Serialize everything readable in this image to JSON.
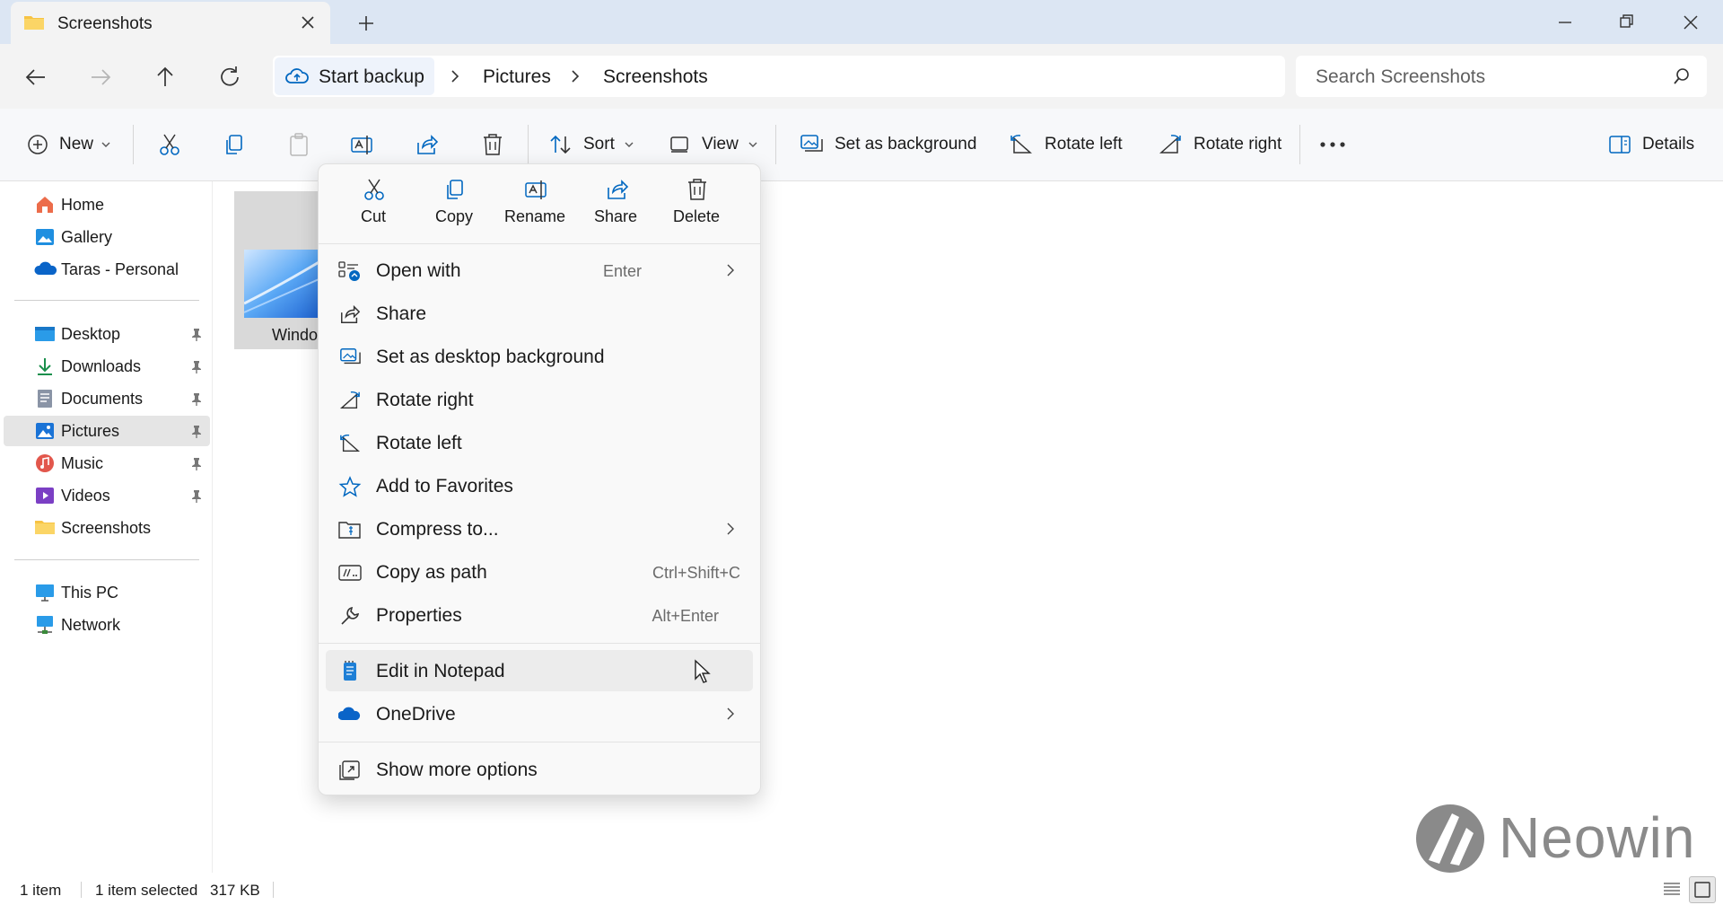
{
  "window": {
    "tab_title": "Screenshots"
  },
  "address": {
    "crumbs": [
      "Start backup",
      "Pictures",
      "Screenshots"
    ],
    "search_placeholder": "Search Screenshots"
  },
  "toolbar": {
    "new_label": "New",
    "sort_label": "Sort",
    "view_label": "View",
    "set_bg_label": "Set as background",
    "rotate_left_label": "Rotate left",
    "rotate_right_label": "Rotate right",
    "details_label": "Details"
  },
  "sidebar": {
    "top_items": [
      {
        "label": "Home",
        "icon": "home-icon"
      },
      {
        "label": "Gallery",
        "icon": "gallery-icon"
      },
      {
        "label": "Taras - Personal",
        "icon": "onedrive-icon"
      }
    ],
    "pinned_items": [
      {
        "label": "Desktop",
        "icon": "desktop-icon",
        "pinned": true
      },
      {
        "label": "Downloads",
        "icon": "downloads-icon",
        "pinned": true
      },
      {
        "label": "Documents",
        "icon": "documents-icon",
        "pinned": true
      },
      {
        "label": "Pictures",
        "icon": "pictures-icon",
        "pinned": true,
        "selected": true
      },
      {
        "label": "Music",
        "icon": "music-icon",
        "pinned": true
      },
      {
        "label": "Videos",
        "icon": "videos-icon",
        "pinned": true
      },
      {
        "label": "Screenshots",
        "icon": "folder-icon",
        "pinned": false
      }
    ],
    "bottom_items": [
      {
        "label": "This PC",
        "icon": "pc-icon"
      },
      {
        "label": "Network",
        "icon": "network-icon"
      }
    ]
  },
  "file": {
    "label": "Windo"
  },
  "context_menu": {
    "quick_actions": [
      {
        "label": "Cut",
        "icon": "cut-icon"
      },
      {
        "label": "Copy",
        "icon": "copy-icon"
      },
      {
        "label": "Rename",
        "icon": "rename-icon"
      },
      {
        "label": "Share",
        "icon": "share-icon"
      },
      {
        "label": "Delete",
        "icon": "delete-icon"
      }
    ],
    "items": [
      {
        "label": "Open with",
        "shortcut": "Enter",
        "submenu": true,
        "icon": "open-with-icon"
      },
      {
        "label": "Share",
        "shortcut": "",
        "submenu": false,
        "icon": "share-icon"
      },
      {
        "label": "Set as desktop background",
        "shortcut": "",
        "submenu": false,
        "icon": "background-icon"
      },
      {
        "label": "Rotate right",
        "shortcut": "",
        "submenu": false,
        "icon": "rotate-right-icon"
      },
      {
        "label": "Rotate left",
        "shortcut": "",
        "submenu": false,
        "icon": "rotate-left-icon"
      },
      {
        "label": "Add to Favorites",
        "shortcut": "",
        "submenu": false,
        "icon": "star-icon"
      },
      {
        "label": "Compress to...",
        "shortcut": "",
        "submenu": true,
        "icon": "compress-icon"
      },
      {
        "label": "Copy as path",
        "shortcut": "Ctrl+Shift+C",
        "submenu": false,
        "icon": "copy-path-icon"
      },
      {
        "label": "Properties",
        "shortcut": "Alt+Enter",
        "submenu": false,
        "icon": "properties-icon"
      }
    ],
    "extra_items": [
      {
        "label": "Edit in Notepad",
        "icon": "notepad-icon",
        "hovered": true
      },
      {
        "label": "OneDrive",
        "icon": "onedrive-icon",
        "submenu": true
      }
    ],
    "more_options": {
      "label": "Show more options",
      "icon": "more-options-icon"
    }
  },
  "status": {
    "item_count": "1 item",
    "selected": "1 item selected",
    "size": "317 KB"
  },
  "watermark": {
    "text": "Neowin"
  },
  "colors": {
    "accent": "#0067c0",
    "titlebar": "#dce6f3",
    "folder": "#f7c343",
    "selected_bg": "#e5e5e5"
  }
}
